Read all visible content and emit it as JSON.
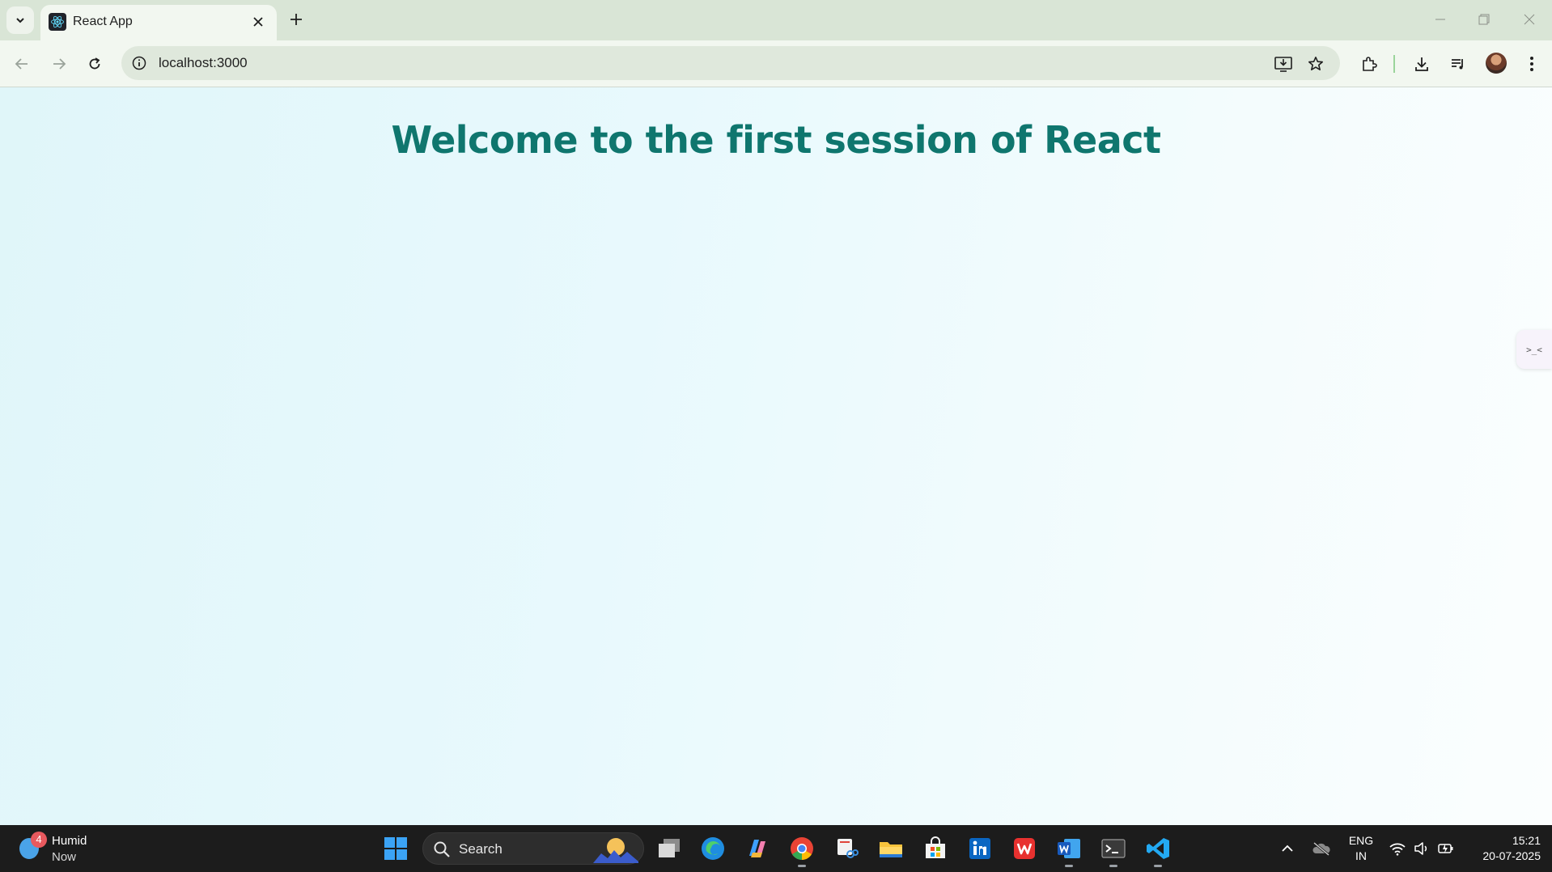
{
  "browser": {
    "tab_title": "React App",
    "url": "localhost:3000"
  },
  "page": {
    "heading": "Welcome to the first session of React",
    "side_widget_label": ">_<"
  },
  "taskbar": {
    "weather_title": "Humid",
    "weather_subtitle": "Now",
    "notification_count": "4",
    "search_label": "Search",
    "language_top": "ENG",
    "language_bottom": "IN",
    "time": "15:21",
    "date": "20-07-2025"
  },
  "colors": {
    "heading": "#0f766e",
    "chrome_frame": "#d9e5d6",
    "toolbar": "#f2f7f0",
    "taskbar": "#1c1c1c"
  },
  "icons": [
    "tab-search-icon",
    "react-favicon-icon",
    "close-icon",
    "plus-icon",
    "minimize-icon",
    "restore-icon",
    "back-arrow-icon",
    "forward-arrow-icon",
    "reload-icon",
    "info-icon",
    "install-app-icon",
    "star-icon",
    "extensions-icon",
    "download-icon",
    "media-control-icon",
    "menu-dots-icon",
    "windows-start-icon",
    "task-view-icon",
    "edge-icon",
    "copilot-icon",
    "chrome-icon",
    "snipping-tool-icon",
    "file-explorer-icon",
    "store-icon",
    "linkedin-icon",
    "wps-icon",
    "word-icon",
    "terminal-icon",
    "vscode-icon",
    "chevron-up-icon",
    "onedrive-icon",
    "wifi-icon",
    "volume-icon",
    "battery-icon"
  ]
}
